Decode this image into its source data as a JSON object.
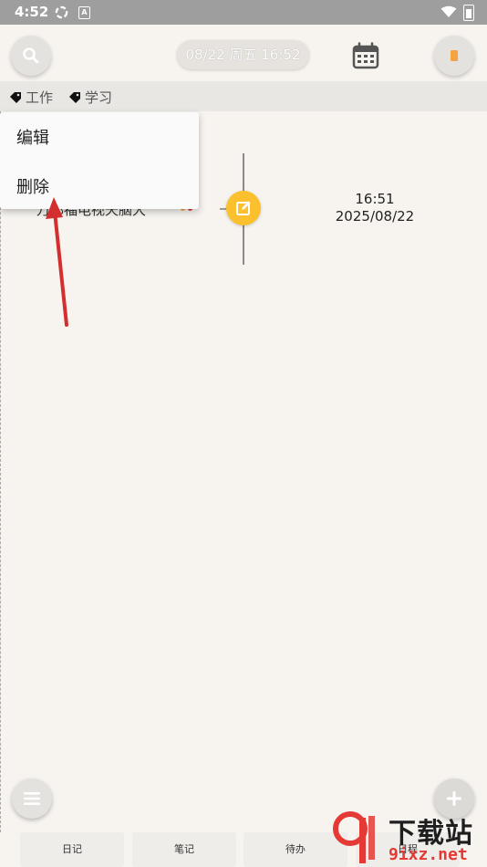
{
  "status_bar": {
    "time": "4:52",
    "badge": "A"
  },
  "header": {
    "date": "08/22 周五  16:52"
  },
  "tags": [
    {
      "label": "工作"
    },
    {
      "label": "学习"
    }
  ],
  "entry": {
    "title": "万邦福电视天脑大",
    "time": "16:51",
    "date": "2025/08/22"
  },
  "context_menu": {
    "items": [
      {
        "label": "编辑"
      },
      {
        "label": "删除"
      }
    ]
  },
  "bottom_nav": {
    "tabs": [
      {
        "label": "日记"
      },
      {
        "label": "笔记"
      },
      {
        "label": "待办"
      },
      {
        "label": "日程"
      }
    ]
  },
  "watermark": {
    "line1": "下载站",
    "line2": "9ixz.net"
  },
  "colors": {
    "accent": "#fbc02d",
    "annotation": "#d32f2f",
    "background": "#f7f4f0"
  }
}
